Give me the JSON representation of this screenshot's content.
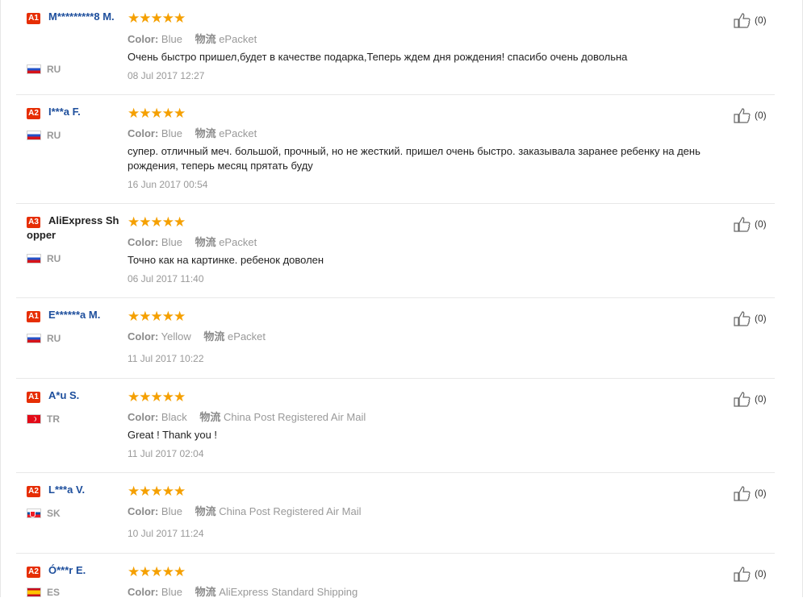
{
  "labels": {
    "color": "Color:",
    "shipping": "物流"
  },
  "reviews": [
    {
      "badge": "A1",
      "user": "M*********8 M.",
      "user_style": "link",
      "country": "RU",
      "flag": "ru",
      "stars": "★★★★★",
      "color": "Blue",
      "shipping": "ePacket",
      "text": "Очень быстро пришел,будет в качестве подарка,Теперь ждем дня рождения! спасибо очень довольна",
      "date": "08 Jul 2017 12:27",
      "helpful": "(0)"
    },
    {
      "badge": "A2",
      "user": "I***a F.",
      "user_style": "link",
      "country": "RU",
      "flag": "ru",
      "stars": "★★★★★",
      "color": "Blue",
      "shipping": "ePacket",
      "text": "супер. отличный меч. большой, прочный, но не жесткий. пришел очень быстро. заказывала заранее ребенку на день рождения, теперь месяц прятать буду",
      "date": "16 Jun 2017 00:54",
      "helpful": "(0)"
    },
    {
      "badge": "A3",
      "user": "AliExpress Shopper",
      "user_style": "plain",
      "country": "RU",
      "flag": "ru",
      "stars": "★★★★★",
      "color": "Blue",
      "shipping": "ePacket",
      "text": "Точно как на картинке. ребенок доволен",
      "date": "06 Jul 2017 11:40",
      "helpful": "(0)"
    },
    {
      "badge": "A1",
      "user": "E******a M.",
      "user_style": "link",
      "country": "RU",
      "flag": "ru",
      "stars": "★★★★★",
      "color": "Yellow",
      "shipping": "ePacket",
      "text": "",
      "date": "11 Jul 2017 10:22",
      "helpful": "(0)"
    },
    {
      "badge": "A1",
      "user": "A*u S.",
      "user_style": "link",
      "country": "TR",
      "flag": "tr",
      "stars": "★★★★★",
      "color": "Black",
      "shipping": "China Post Registered Air Mail",
      "text": "Great ! Thank you !",
      "date": "11 Jul 2017 02:04",
      "helpful": "(0)"
    },
    {
      "badge": "A2",
      "user": "L***a V.",
      "user_style": "link",
      "country": "SK",
      "flag": "sk",
      "stars": "★★★★★",
      "color": "Blue",
      "shipping": "China Post Registered Air Mail",
      "text": "",
      "date": "10 Jul 2017 11:24",
      "helpful": "(0)"
    },
    {
      "badge": "A2",
      "user": "Ó***r E.",
      "user_style": "link",
      "country": "ES",
      "flag": "es",
      "stars": "★★★★★",
      "color": "Blue",
      "shipping": "AliExpress Standard Shipping",
      "text": "",
      "date": "",
      "helpful": "(0)"
    }
  ]
}
